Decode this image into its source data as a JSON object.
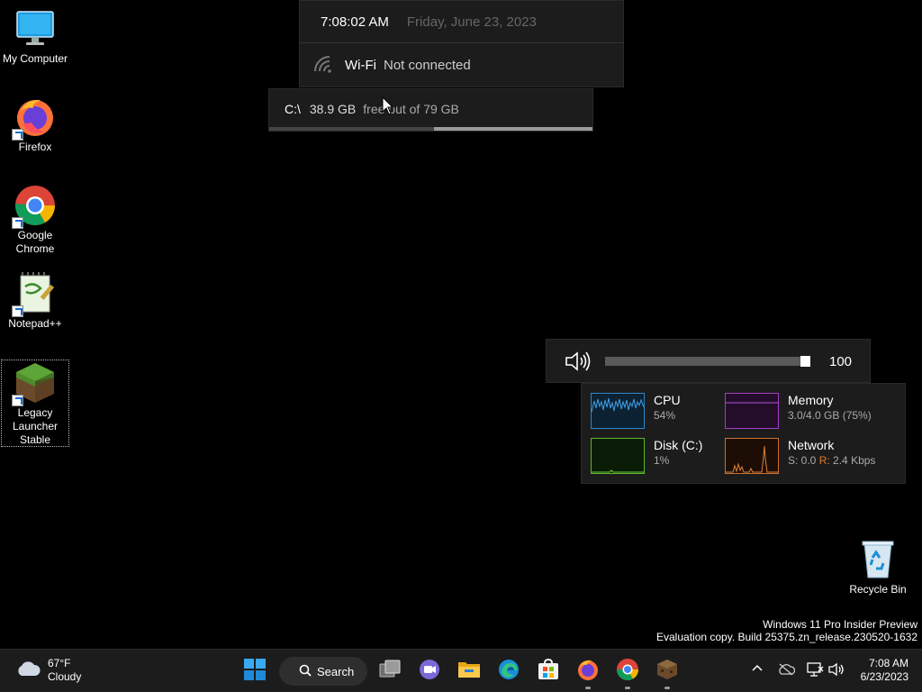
{
  "desktop": {
    "icons": [
      {
        "label": "My Computer"
      },
      {
        "label": "Firefox"
      },
      {
        "label": "Google Chrome"
      },
      {
        "label": "Notepad++"
      },
      {
        "label": "Legacy Launcher Stable"
      },
      {
        "label": "Recycle Bin"
      }
    ]
  },
  "widgets": {
    "clock": {
      "time": "7:08:02 AM",
      "date": "Friday, June 23, 2023"
    },
    "wifi": {
      "label": "Wi-Fi",
      "status": "Not connected"
    },
    "disk": {
      "drive": "C:\\",
      "free": "38.9 GB",
      "of_text": "free out of 79 GB",
      "used_fraction": 0.51
    },
    "volume": {
      "value": "100",
      "level_fraction": 1.0
    },
    "performance": {
      "cpu": {
        "name": "CPU",
        "value": "54%",
        "color": "#2f86c9"
      },
      "memory": {
        "name": "Memory",
        "value": "3.0/4.0 GB (75%)",
        "color": "#a23fc4"
      },
      "disk": {
        "name": "Disk (C:)",
        "value": "1%",
        "color": "#5cb82c"
      },
      "network": {
        "name": "Network",
        "sent": "S: 0.0",
        "recv_label": "R:",
        "recv": "2.4 Kbps",
        "color": "#c9712f"
      }
    }
  },
  "watermark": {
    "line1": "Windows 11 Pro Insider Preview",
    "line2": "Evaluation copy. Build 25375.zn_release.230520-1632"
  },
  "taskbar": {
    "weather": {
      "temp": "67°F",
      "condition": "Cloudy",
      "icon": "cloud-icon"
    },
    "search_label": "Search",
    "apps": [
      "start-icon",
      "task-view-icon",
      "chat-icon",
      "file-explorer-icon",
      "edge-icon",
      "store-icon",
      "firefox-icon",
      "chrome-icon",
      "minecraft-launcher-icon"
    ],
    "clock": {
      "time": "7:08 AM",
      "date": "6/23/2023"
    }
  }
}
